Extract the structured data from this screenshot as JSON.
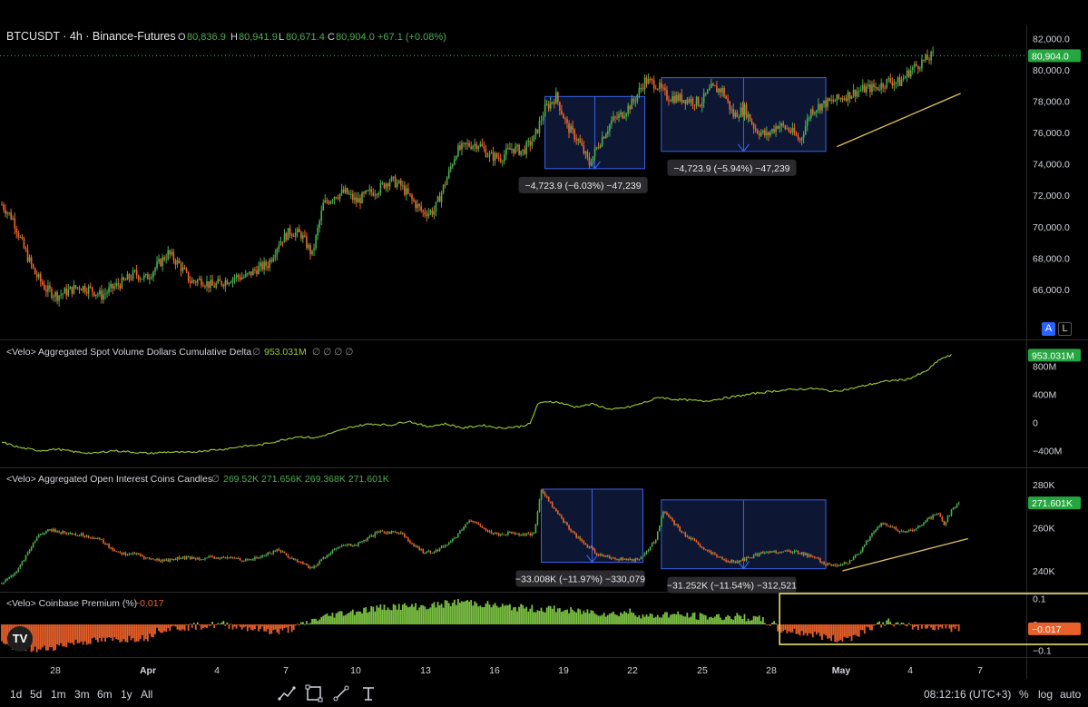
{
  "header": {
    "symbol": "BTCUSDT · 4h · Binance-Futures",
    "o_label": "O",
    "o_value": "80,836.9",
    "h_label": "H",
    "h_value": "80,941.9",
    "l_label": "L",
    "l_value": "80,671.4",
    "c_label": "C",
    "c_value": "80,904.0",
    "change": "+67.1 (+0.08%)"
  },
  "colors": {
    "up": "#4caf50",
    "down": "#f0642c",
    "line": "#9acd32",
    "box_fill": "#0f1b3c",
    "box_stroke": "#3b63e8",
    "trend": "#e0c060",
    "highlight": "#e8e070",
    "label_green": "#26a641"
  },
  "panes": {
    "price": {
      "last_label": "80,904.0",
      "a_button": "A",
      "l_button": "L",
      "measure_1": "−4,723.9 (−6.03%) −47,239",
      "measure_2": "−4,723.9 (−5.94%) −47,239"
    },
    "cvd": {
      "title": "<Velo> Aggregated Spot Volume Dollars Cumulative Delta",
      "value": "953.031M",
      "extra": "∅ ∅ ∅ ∅",
      "last_label": "953.031M"
    },
    "oi": {
      "title": "<Velo> Aggregated Open Interest Coins Candles",
      "values": "269.52K 271.656K 269.368K 271.601K",
      "last_label": "271.601K",
      "measure_1": "−33.008K (−11.97%) −330,079",
      "measure_2": "−31.252K (−11.54%) −312,521"
    },
    "premium": {
      "title": "<Velo> Coinbase Premium (%)",
      "value": "−0.017",
      "last_label": "−0.017"
    }
  },
  "toolbar": {
    "timeframes": [
      "1d",
      "5d",
      "1m",
      "3m",
      "6m",
      "1y",
      "All"
    ],
    "clock": "08:12:16 (UTC+3)",
    "percent": "%",
    "log": "log",
    "auto": "auto"
  },
  "chart_data": [
    {
      "type": "candlestick",
      "title": "BTCUSDT · 4h · Binance-Futures",
      "y_ticks": [
        "82,000.0",
        "80,000.0",
        "78,000.0",
        "76,000.0",
        "74,000.0",
        "72,000.0",
        "70,000.0",
        "68,000.0",
        "66,000.0"
      ],
      "ylim": [
        64200,
        82600
      ],
      "x_ticks": [
        "28",
        "Apr",
        "4",
        "7",
        "10",
        "13",
        "16",
        "19",
        "22",
        "25",
        "28",
        "May",
        "4",
        "7"
      ],
      "close_path": [
        [
          0,
          71400
        ],
        [
          6,
          70500
        ],
        [
          12,
          68600
        ],
        [
          18,
          67000
        ],
        [
          24,
          66000
        ],
        [
          30,
          65600
        ],
        [
          36,
          65900
        ],
        [
          42,
          66200
        ],
        [
          48,
          66000
        ],
        [
          54,
          65600
        ],
        [
          60,
          66100
        ],
        [
          66,
          66500
        ],
        [
          72,
          67000
        ],
        [
          78,
          66700
        ],
        [
          84,
          67500
        ],
        [
          90,
          68300
        ],
        [
          96,
          67600
        ],
        [
          102,
          66500
        ],
        [
          108,
          66600
        ],
        [
          114,
          66200
        ],
        [
          120,
          66500
        ],
        [
          126,
          66800
        ],
        [
          132,
          66800
        ],
        [
          138,
          67300
        ],
        [
          144,
          67600
        ],
        [
          150,
          69000
        ],
        [
          156,
          69700
        ],
        [
          162,
          69500
        ],
        [
          168,
          68200
        ],
        [
          174,
          71400
        ],
        [
          180,
          72000
        ],
        [
          186,
          72200
        ],
        [
          192,
          71600
        ],
        [
          198,
          72100
        ],
        [
          204,
          72400
        ],
        [
          210,
          73000
        ],
        [
          216,
          72600
        ],
        [
          222,
          71700
        ],
        [
          228,
          70900
        ],
        [
          234,
          71000
        ],
        [
          240,
          72800
        ],
        [
          246,
          74800
        ],
        [
          252,
          75200
        ],
        [
          258,
          75300
        ],
        [
          264,
          74500
        ],
        [
          270,
          74400
        ],
        [
          276,
          75000
        ],
        [
          282,
          74800
        ],
        [
          288,
          75600
        ],
        [
          294,
          77500
        ],
        [
          300,
          78300
        ],
        [
          306,
          76400
        ],
        [
          312,
          75500
        ],
        [
          318,
          74000
        ],
        [
          324,
          75500
        ],
        [
          330,
          76700
        ],
        [
          336,
          77200
        ],
        [
          342,
          78000
        ],
        [
          348,
          79300
        ],
        [
          354,
          79100
        ],
        [
          360,
          78300
        ],
        [
          366,
          78200
        ],
        [
          372,
          78100
        ],
        [
          378,
          77900
        ],
        [
          384,
          78800
        ],
        [
          390,
          78700
        ],
        [
          396,
          77100
        ],
        [
          402,
          77500
        ],
        [
          408,
          76200
        ],
        [
          414,
          75800
        ],
        [
          420,
          76500
        ],
        [
          426,
          76200
        ],
        [
          432,
          75500
        ],
        [
          438,
          77400
        ],
        [
          444,
          77800
        ],
        [
          450,
          78000
        ],
        [
          456,
          78300
        ],
        [
          462,
          78600
        ],
        [
          468,
          78800
        ],
        [
          474,
          78900
        ],
        [
          480,
          79300
        ],
        [
          486,
          79200
        ],
        [
          492,
          80000
        ],
        [
          498,
          80500
        ],
        [
          504,
          80900
        ]
      ],
      "measure_boxes": [
        {
          "x0": 294,
          "x1": 348,
          "y_high": 78300,
          "y_low": 73700,
          "label": "−4,723.9 (−6.03%) −47,239"
        },
        {
          "x0": 357,
          "x1": 446,
          "y_high": 79500,
          "y_low": 74800,
          "label": "−4,723.9 (−5.94%) −47,239"
        }
      ],
      "trendline": [
        [
          452,
          75100
        ],
        [
          519,
          78500
        ]
      ],
      "last": "80,904.0"
    },
    {
      "type": "line",
      "title": "<Velo> Aggregated Spot Volume Dollars Cumulative Delta",
      "y_ticks": [
        "800M",
        "400M",
        "0",
        "−400M"
      ],
      "ylim": [
        -600,
        1100
      ],
      "path": [
        [
          0,
          -280
        ],
        [
          10,
          -360
        ],
        [
          20,
          -400
        ],
        [
          30,
          -380
        ],
        [
          40,
          -420
        ],
        [
          50,
          -440
        ],
        [
          60,
          -400
        ],
        [
          70,
          -420
        ],
        [
          80,
          -440
        ],
        [
          90,
          -420
        ],
        [
          100,
          -430
        ],
        [
          110,
          -400
        ],
        [
          120,
          -380
        ],
        [
          130,
          -340
        ],
        [
          140,
          -320
        ],
        [
          150,
          -260
        ],
        [
          160,
          -200
        ],
        [
          170,
          -220
        ],
        [
          180,
          -140
        ],
        [
          190,
          -60
        ],
        [
          200,
          -20
        ],
        [
          210,
          -40
        ],
        [
          220,
          20
        ],
        [
          230,
          -60
        ],
        [
          240,
          -20
        ],
        [
          250,
          -80
        ],
        [
          260,
          -40
        ],
        [
          270,
          -80
        ],
        [
          280,
          -60
        ],
        [
          286,
          -20
        ],
        [
          290,
          260
        ],
        [
          296,
          300
        ],
        [
          302,
          280
        ],
        [
          310,
          220
        ],
        [
          320,
          260
        ],
        [
          330,
          180
        ],
        [
          340,
          220
        ],
        [
          350,
          300
        ],
        [
          356,
          360
        ],
        [
          362,
          330
        ],
        [
          370,
          320
        ],
        [
          380,
          300
        ],
        [
          390,
          340
        ],
        [
          400,
          380
        ],
        [
          410,
          420
        ],
        [
          420,
          450
        ],
        [
          430,
          470
        ],
        [
          440,
          480
        ],
        [
          450,
          440
        ],
        [
          460,
          480
        ],
        [
          470,
          540
        ],
        [
          480,
          590
        ],
        [
          490,
          610
        ],
        [
          500,
          720
        ],
        [
          508,
          900
        ],
        [
          514,
          953
        ]
      ],
      "last": "953.031M"
    },
    {
      "type": "candlestick",
      "title": "<Velo> Aggregated Open Interest Coins Candles",
      "y_ticks": [
        "280K",
        "260K",
        "240K"
      ],
      "ylim": [
        232000,
        286000
      ],
      "close_path": [
        [
          0,
          234000
        ],
        [
          8,
          240000
        ],
        [
          14,
          248000
        ],
        [
          20,
          257000
        ],
        [
          26,
          259000
        ],
        [
          32,
          258000
        ],
        [
          40,
          257000
        ],
        [
          48,
          256000
        ],
        [
          54,
          254000
        ],
        [
          60,
          250000
        ],
        [
          66,
          248000
        ],
        [
          72,
          248000
        ],
        [
          78,
          246000
        ],
        [
          84,
          245000
        ],
        [
          90,
          245000
        ],
        [
          96,
          246000
        ],
        [
          102,
          246000
        ],
        [
          108,
          246000
        ],
        [
          114,
          246000
        ],
        [
          120,
          246000
        ],
        [
          126,
          246000
        ],
        [
          132,
          245000
        ],
        [
          138,
          246000
        ],
        [
          144,
          248000
        ],
        [
          150,
          250000
        ],
        [
          156,
          246000
        ],
        [
          162,
          244000
        ],
        [
          168,
          241000
        ],
        [
          174,
          246000
        ],
        [
          180,
          250000
        ],
        [
          186,
          252000
        ],
        [
          192,
          252000
        ],
        [
          198,
          255000
        ],
        [
          204,
          258000
        ],
        [
          210,
          258000
        ],
        [
          216,
          258000
        ],
        [
          222,
          252000
        ],
        [
          228,
          249000
        ],
        [
          234,
          249000
        ],
        [
          240,
          252000
        ],
        [
          246,
          256000
        ],
        [
          252,
          263000
        ],
        [
          258,
          262000
        ],
        [
          264,
          258000
        ],
        [
          270,
          257000
        ],
        [
          276,
          258000
        ],
        [
          282,
          257000
        ],
        [
          288,
          257000
        ],
        [
          292,
          278000
        ],
        [
          298,
          270000
        ],
        [
          304,
          263000
        ],
        [
          310,
          257000
        ],
        [
          316,
          252000
        ],
        [
          322,
          248000
        ],
        [
          330,
          246000
        ],
        [
          340,
          245000
        ],
        [
          346,
          246000
        ],
        [
          350,
          250000
        ],
        [
          354,
          255000
        ],
        [
          358,
          268000
        ],
        [
          362,
          264000
        ],
        [
          368,
          258000
        ],
        [
          374,
          254000
        ],
        [
          380,
          250000
        ],
        [
          386,
          247000
        ],
        [
          392,
          245000
        ],
        [
          398,
          244000
        ],
        [
          404,
          246000
        ],
        [
          410,
          248000
        ],
        [
          416,
          249000
        ],
        [
          422,
          249000
        ],
        [
          428,
          249000
        ],
        [
          434,
          248000
        ],
        [
          440,
          246000
        ],
        [
          446,
          243000
        ],
        [
          452,
          242000
        ],
        [
          458,
          244000
        ],
        [
          464,
          248000
        ],
        [
          470,
          256000
        ],
        [
          476,
          262000
        ],
        [
          482,
          260000
        ],
        [
          488,
          258000
        ],
        [
          494,
          259000
        ],
        [
          500,
          263000
        ],
        [
          506,
          267000
        ],
        [
          510,
          262000
        ],
        [
          514,
          268000
        ],
        [
          518,
          271600
        ]
      ],
      "measure_boxes": [
        {
          "x0": 292,
          "x1": 347,
          "y_high": 278000,
          "y_low": 244000,
          "label": "−33.008K (−11.97%) −330,079"
        },
        {
          "x0": 357,
          "x1": 446,
          "y_high": 273000,
          "y_low": 241000,
          "label": "−31.252K (−11.54%) −312,521"
        }
      ],
      "trendline": [
        [
          455,
          240000
        ],
        [
          523,
          255000
        ]
      ],
      "last": "271.601K"
    },
    {
      "type": "bar",
      "title": "<Velo> Coinbase Premium (%)",
      "y_ticks": [
        "0.1",
        "0",
        "−0.1"
      ],
      "ylim": [
        -0.12,
        0.12
      ],
      "value_path": [
        [
          0,
          -0.08
        ],
        [
          20,
          -0.1
        ],
        [
          40,
          -0.07
        ],
        [
          60,
          -0.06
        ],
        [
          80,
          -0.05
        ],
        [
          84,
          -0.02
        ],
        [
          100,
          -0.01
        ],
        [
          120,
          0.0
        ],
        [
          140,
          -0.02
        ],
        [
          150,
          -0.03
        ],
        [
          160,
          -0.01
        ],
        [
          170,
          0.02
        ],
        [
          180,
          0.04
        ],
        [
          190,
          0.05
        ],
        [
          200,
          0.06
        ],
        [
          210,
          0.07
        ],
        [
          230,
          0.07
        ],
        [
          250,
          0.09
        ],
        [
          260,
          0.08
        ],
        [
          270,
          0.07
        ],
        [
          290,
          0.06
        ],
        [
          300,
          0.06
        ],
        [
          310,
          0.05
        ],
        [
          320,
          0.05
        ],
        [
          330,
          0.04
        ],
        [
          340,
          0.05
        ],
        [
          350,
          0.03
        ],
        [
          360,
          0.04
        ],
        [
          380,
          0.03
        ],
        [
          400,
          0.03
        ],
        [
          410,
          0.02
        ],
        [
          418,
          0.0
        ],
        [
          420,
          -0.02
        ],
        [
          440,
          -0.04
        ],
        [
          452,
          -0.06
        ],
        [
          460,
          -0.05
        ],
        [
          470,
          -0.01
        ],
        [
          480,
          0.01
        ],
        [
          490,
          -0.01
        ],
        [
          500,
          -0.01
        ],
        [
          510,
          -0.01
        ],
        [
          518,
          -0.02
        ]
      ],
      "highlight_box": {
        "x0": 421,
        "x1": 592
      },
      "last": "−0.017"
    }
  ]
}
